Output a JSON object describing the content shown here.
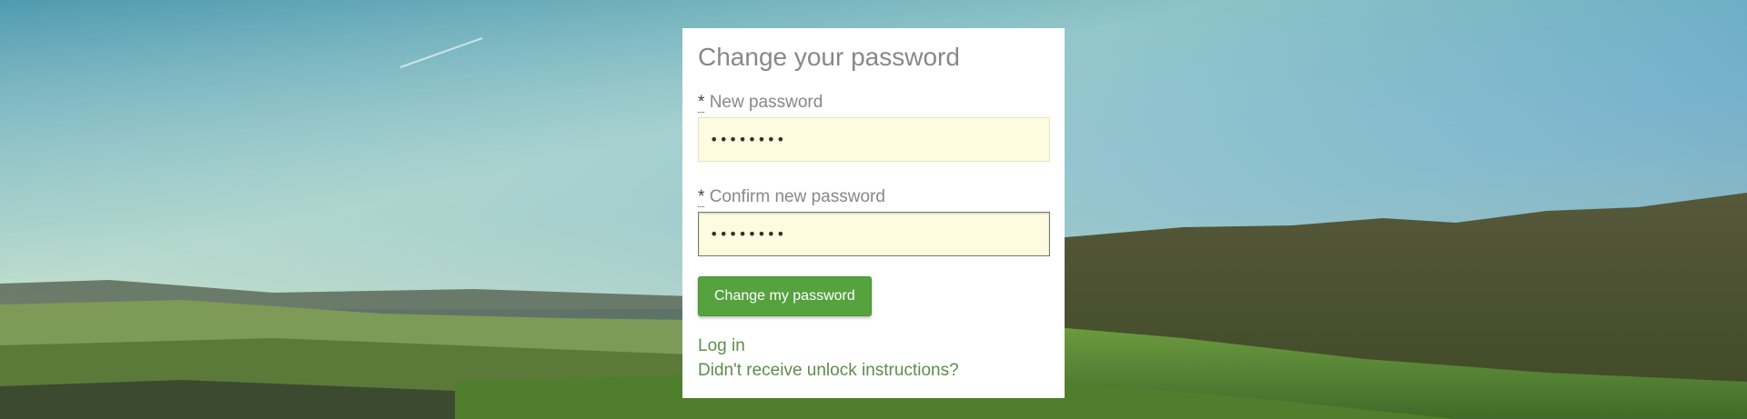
{
  "form": {
    "title": "Change your password",
    "required_marker": "*",
    "new_password_label": "New password",
    "new_password_value": "••••••••",
    "confirm_password_label": "Confirm new password",
    "confirm_password_value": "••••••••",
    "submit_label": "Change my password"
  },
  "links": {
    "login": "Log in",
    "unlock": "Didn't receive unlock instructions?"
  },
  "colors": {
    "submit_button": "#55a23f",
    "link": "#5e8d4c",
    "input_background": "#fefce0"
  }
}
